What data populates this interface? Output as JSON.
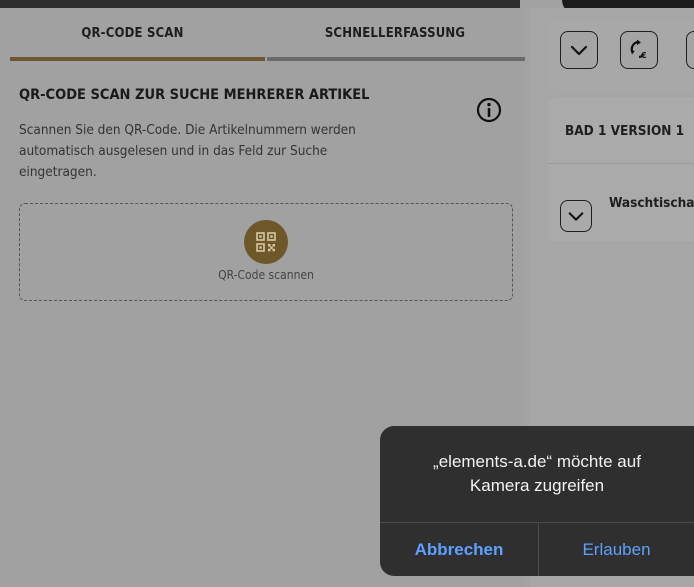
{
  "tabs": [
    {
      "label": "QR-CODE SCAN",
      "active": true
    },
    {
      "label": "SCHNELLERFASSUNG",
      "active": false
    }
  ],
  "qr_section": {
    "title": "QR-CODE SCAN ZUR SUCHE MEHRERER ARTIKEL",
    "description_lines": [
      "Scannen Sie den QR-Code. Die Artikelnummern werden",
      "automatisch ausgelesen und in das Feld zur Suche",
      "eingetragen."
    ],
    "scan_button_label": "QR-Code scannen",
    "info_icon": "info-icon"
  },
  "right_panel": {
    "toolbar_icons": [
      "chevron-down-icon",
      "sync-euro-icon"
    ],
    "card_title": "BAD 1 VERSION 1",
    "card_row_label": "Waschtischa"
  },
  "dialog": {
    "message_lines": [
      "„elements-a.de“ möchte auf",
      "Kamera zugreifen"
    ],
    "cancel_label": "Abbrechen",
    "allow_label": "Erlauben"
  },
  "colors": {
    "accent_brown": "#6e5729",
    "ios_blue": "#5da1ff",
    "dialog_bg": "#2f2f2f"
  }
}
